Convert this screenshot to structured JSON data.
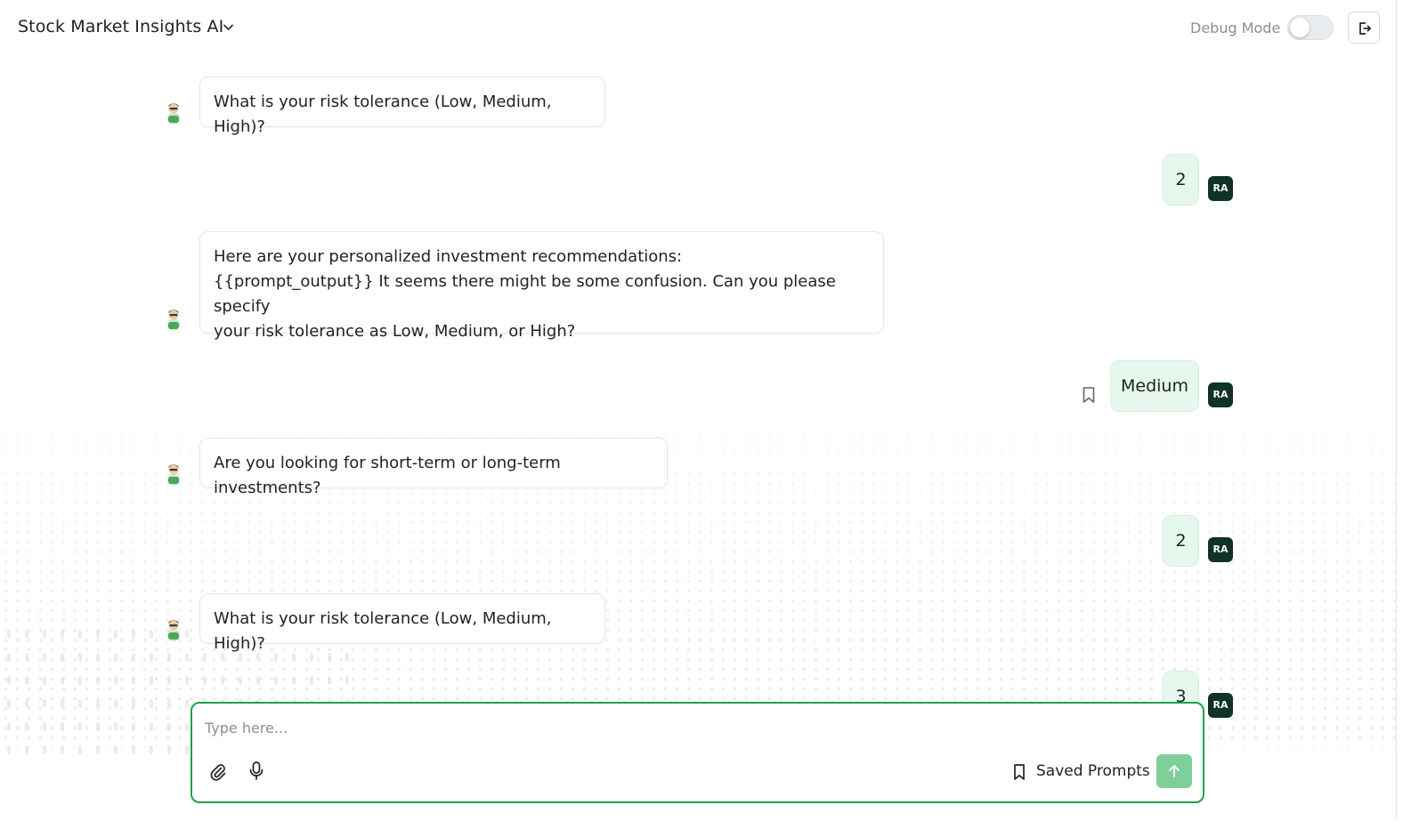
{
  "header": {
    "title": "Stock Market Insights AI",
    "debug_label": "Debug Mode",
    "debug_enabled": false
  },
  "messages": [
    {
      "role": "bot",
      "text": "What is your risk tolerance (Low, Medium, High)?"
    },
    {
      "role": "user",
      "text": "2",
      "avatar": "RA"
    },
    {
      "role": "bot",
      "lines": [
        "Here are your personalized investment recommendations:",
        "{{prompt_output}} It seems there might be some confusion. Can you please specify",
        "your risk tolerance as Low, Medium, or High?"
      ]
    },
    {
      "role": "user",
      "text": "Medium",
      "avatar": "RA",
      "bookmark": true
    },
    {
      "role": "bot",
      "text": "Are you looking for short-term or long-term investments?"
    },
    {
      "role": "user",
      "text": "2",
      "avatar": "RA"
    },
    {
      "role": "bot",
      "text": "What is your risk tolerance (Low, Medium, High)?"
    },
    {
      "role": "user",
      "text": "3",
      "avatar": "RA"
    }
  ],
  "composer": {
    "placeholder": "Type here...",
    "saved_prompts_label": "Saved Prompts"
  },
  "colors": {
    "accent": "#22a04e",
    "send_button": "#7fcf9a",
    "user_bubble": "#e6f8ee",
    "user_avatar": "#0f3324"
  }
}
